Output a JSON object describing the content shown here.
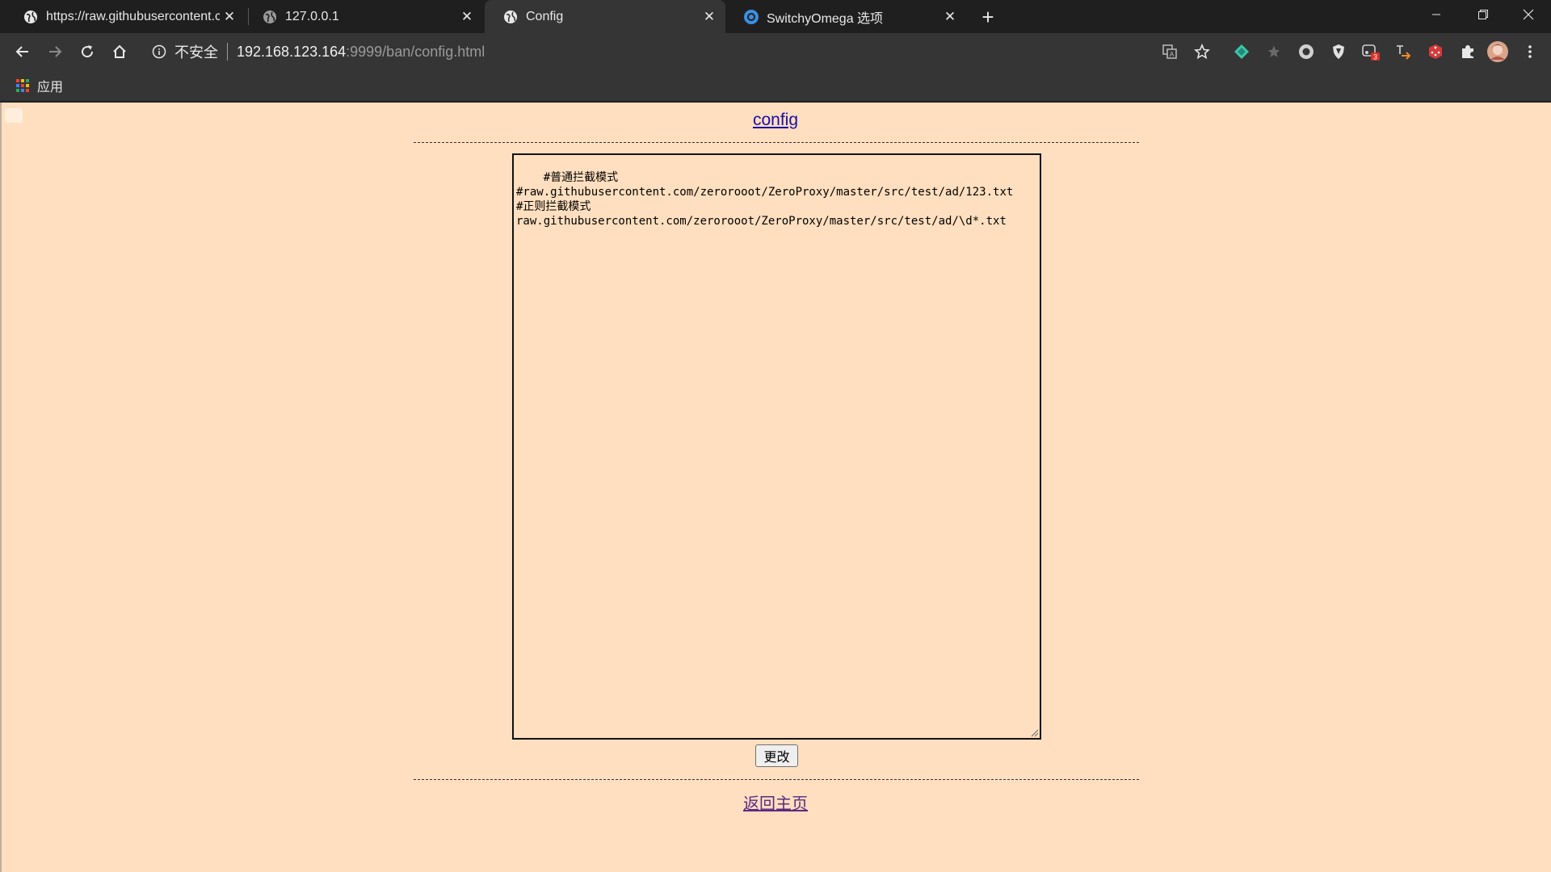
{
  "browser": {
    "tabs": [
      {
        "title": "https://raw.githubusercontent.com",
        "active": false,
        "favicon": "globe-icon"
      },
      {
        "title": "127.0.0.1",
        "active": false,
        "favicon": "globe-icon"
      },
      {
        "title": "Config",
        "active": true,
        "favicon": "globe-icon"
      },
      {
        "title": "SwitchyOmega 选项",
        "active": false,
        "favicon": "switchyomega-icon"
      }
    ],
    "address": {
      "security_label": "不安全",
      "host": "192.168.123.164",
      "path": ":9999/ban/config.html"
    },
    "extensions": [
      {
        "icon": "diamond-extension-icon",
        "color": "#3ec7a8"
      },
      {
        "icon": "star-extension-icon",
        "color": "#6a6a6a"
      },
      {
        "icon": "circle-extension-icon",
        "color": "#d0d0d0"
      },
      {
        "icon": "shield-extension-icon",
        "color": "#e0e0e0"
      },
      {
        "icon": "badge-extension-icon",
        "color": "#d0d0d0",
        "badge": "3"
      },
      {
        "icon": "translate-extension-icon",
        "color": "#f08a24"
      },
      {
        "icon": "dice-extension-icon",
        "color": "#d63a3a"
      },
      {
        "icon": "puzzle-icon",
        "color": "#e8e8e8"
      }
    ],
    "bookmarks": {
      "apps_label": "应用"
    }
  },
  "page": {
    "heading_link": "config",
    "editor_text": "#普通拦截模式\n#raw.githubusercontent.com/zerorooot/ZeroProxy/master/src/test/ad/123.txt\n#正则拦截模式\nraw.githubusercontent.com/zerorooot/ZeroProxy/master/src/test/ad/\\d*.txt",
    "submit_label": "更改",
    "back_link": "返回主页"
  },
  "colors": {
    "page_background": "#ffdfbf",
    "link": "#1a0dab",
    "visited_link": "#5a2a82",
    "chrome_dark": "#1f1f1f",
    "chrome_toolbar": "#353535"
  }
}
